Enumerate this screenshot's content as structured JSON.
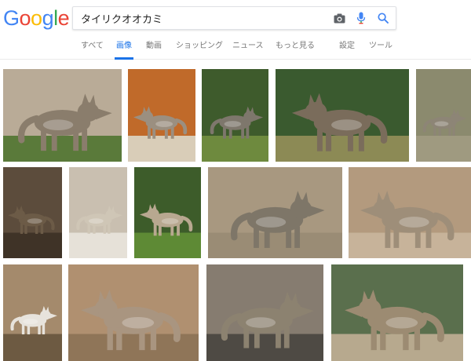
{
  "logo": {
    "letters": [
      "G",
      "o",
      "o",
      "g",
      "l",
      "e"
    ],
    "colors": [
      "#4285F4",
      "#EA4335",
      "#FBBC05",
      "#4285F4",
      "#34A853",
      "#EA4335"
    ]
  },
  "search": {
    "query": "タイリクオオカミ"
  },
  "icons": {
    "camera": "camera-icon",
    "mic": "microphone-icon",
    "search": "search-icon"
  },
  "tabs": [
    {
      "label": "すべて",
      "active": false
    },
    {
      "label": "画像",
      "active": true
    },
    {
      "label": "動画",
      "active": false
    },
    {
      "label": "ショッピング",
      "active": false
    },
    {
      "label": "ニュース",
      "active": false
    },
    {
      "label": "もっと見る",
      "active": false
    },
    {
      "label": "設定",
      "active": false
    },
    {
      "label": "ツール",
      "active": false
    }
  ],
  "colors": {
    "accent": "#1a73e8",
    "tab_text": "#777777",
    "mic_blue": "#4285F4",
    "mic_red": "#EA4335"
  },
  "results": {
    "rows": [
      [
        {
          "scene": "wolf walking on rocks",
          "bg": "#b9ab97",
          "ground": "#5a7a3a",
          "fur": "#8a7d6c"
        },
        {
          "scene": "wolf face close-up",
          "bg": "#c06a2a",
          "ground": "#d9cdb8",
          "fur": "#9b8f80"
        },
        {
          "scene": "wolf standing in forest",
          "bg": "#3e5b2c",
          "ground": "#6e8a3e",
          "fur": "#7e776c"
        },
        {
          "scene": "wolf pack in forest",
          "bg": "#3a5a2f",
          "ground": "#8c8a55",
          "fur": "#7a6c5b"
        },
        {
          "scene": "wolf partial view",
          "bg": "#8b8a6e",
          "ground": "#9f9a80",
          "fur": "#8d8576"
        }
      ],
      [
        {
          "scene": "snarling wolf",
          "bg": "#5c4c3c",
          "ground": "#3f3327",
          "fur": "#6c5b47"
        },
        {
          "scene": "white wolf pups",
          "bg": "#c9bfb0",
          "ground": "#e6e1d8",
          "fur": "#cfc6b6"
        },
        {
          "scene": "wolf sitting on grass",
          "bg": "#3d5c2a",
          "ground": "#5e8a35",
          "fur": "#b8a890"
        },
        {
          "scene": "wolf on rock wall",
          "bg": "#a89880",
          "ground": "#9a8c75",
          "fur": "#7e7668"
        },
        {
          "scene": "wolves against rock",
          "bg": "#b39a7e",
          "ground": "#c7b39a",
          "fur": "#9e8e79"
        }
      ],
      [
        {
          "scene": "white wolf howling",
          "bg": "#a48a6c",
          "ground": "#6d5a42",
          "fur": "#e7e3dc"
        },
        {
          "scene": "wolves howling on rocks",
          "bg": "#b09070",
          "ground": "#8f7558",
          "fur": "#a99580"
        },
        {
          "scene": "wolf running on pavement",
          "bg": "#867c70",
          "ground": "#4e4a44",
          "fur": "#8c8270"
        },
        {
          "scene": "wolves howling by fence",
          "bg": "#5a6f4d",
          "ground": "#b7a98e",
          "fur": "#9c8b72"
        }
      ]
    ]
  }
}
